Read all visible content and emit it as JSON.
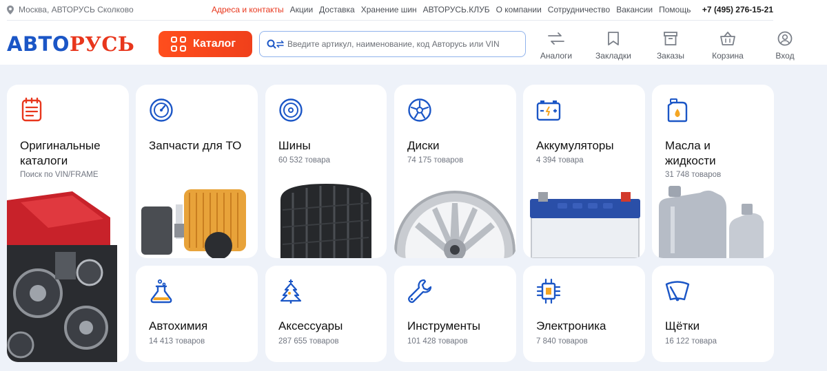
{
  "header": {
    "location": "Москва, АВТОРУСЬ Сколково",
    "top_links": [
      {
        "label": "Адреса и контакты",
        "accent": true
      },
      {
        "label": "Акции",
        "accent": false
      },
      {
        "label": "Доставка",
        "accent": false
      },
      {
        "label": "Хранение шин",
        "accent": false
      },
      {
        "label": "АВТОРУСЬ.КЛУБ",
        "accent": false
      },
      {
        "label": "О компании",
        "accent": false
      },
      {
        "label": "Сотрудничество",
        "accent": false
      },
      {
        "label": "Вакансии",
        "accent": false
      },
      {
        "label": "Помощь",
        "accent": false
      }
    ],
    "phone": "+7 (495) 276-15-21",
    "logo_part1": "АВТО",
    "logo_part2": "РУСЬ",
    "catalog_label": "Каталог",
    "search_placeholder": "Введите артикул, наименование, код Авторусь или VIN",
    "actions": {
      "analogs": "Аналоги",
      "bookmarks": "Закладки",
      "orders": "Заказы",
      "cart": "Корзина",
      "login": "Вход"
    }
  },
  "colors": {
    "brand_blue": "#1b56c6",
    "brand_red": "#e8361c",
    "accent_orange": "#ff4e1d",
    "background": "#eef2f9"
  },
  "categories": {
    "catalogs": {
      "title_l1": "Оригинальные",
      "title_l2": "каталоги",
      "subtitle": "Поиск по VIN/FRAME",
      "icon": "catalog-list-icon"
    },
    "service_parts": {
      "title": "Запчасти для ТО",
      "icon": "gauge-icon"
    },
    "tires": {
      "title": "Шины",
      "subtitle": "60 532 товара",
      "icon": "tire-icon"
    },
    "wheels": {
      "title": "Диски",
      "subtitle": "74 175 товаров",
      "icon": "wheel-rim-icon"
    },
    "batteries": {
      "title": "Аккумуляторы",
      "subtitle": "4 394 товара",
      "icon": "battery-icon"
    },
    "oils": {
      "title_l1": "Масла и",
      "title_l2": "жидкости",
      "subtitle": "31 748 товаров",
      "icon": "oil-canister-icon"
    },
    "chemistry": {
      "title": "Автохимия",
      "subtitle": "14 413 товаров",
      "icon": "flask-icon"
    },
    "accessories": {
      "title": "Аксессуары",
      "subtitle": "287 655 товаров",
      "icon": "air-freshener-icon"
    },
    "tools": {
      "title": "Инструменты",
      "subtitle": "101 428 товаров",
      "icon": "wrench-icon"
    },
    "electronics": {
      "title": "Электроника",
      "subtitle": "7 840 товаров",
      "icon": "chip-icon"
    },
    "wipers": {
      "title": "Щётки",
      "subtitle": "16 122 товара",
      "icon": "wiper-icon"
    }
  }
}
